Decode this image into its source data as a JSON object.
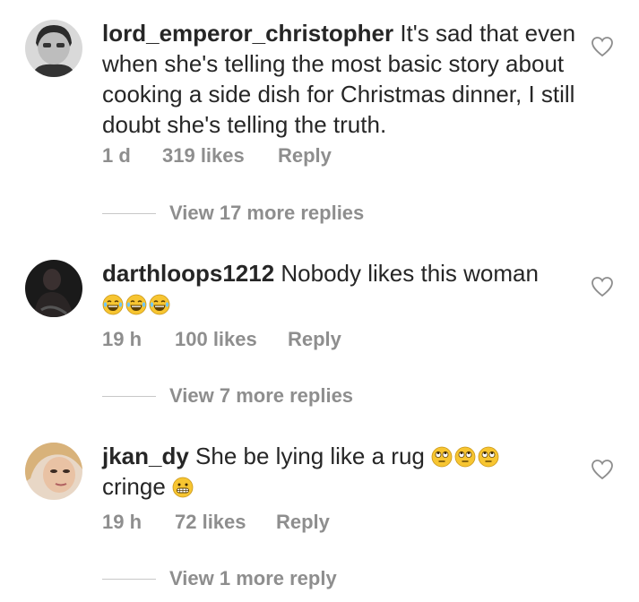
{
  "comments": [
    {
      "username": "lord_emperor_christopher",
      "text": " It's sad that even when she's telling the most basic story about cooking a side dish for Christmas dinner, I still doubt she's telling the truth.",
      "time": "1 d",
      "likes": "319 likes",
      "reply": "Reply",
      "view_replies": "View 17 more replies"
    },
    {
      "username": "darthloops1212",
      "text": " Nobody likes this woman",
      "emojis": [
        "laughing-tears-emoji",
        "laughing-tears-emoji",
        "laughing-tears-emoji"
      ],
      "time": "19 h",
      "likes": "100 likes",
      "reply": "Reply",
      "view_replies": "View 7 more replies"
    },
    {
      "username": "jkan_dy",
      "text": " She be lying like a rug ",
      "text2": "cringe ",
      "emojis": [
        "eye-roll-emoji",
        "eye-roll-emoji",
        "eye-roll-emoji"
      ],
      "emojis2": [
        "grimacing-emoji"
      ],
      "time": "19 h",
      "likes": "72 likes",
      "reply": "Reply",
      "view_replies": "View 1 more reply"
    }
  ],
  "colors": {
    "text": "#262626",
    "meta": "#8e8e8e",
    "emoji": "#f7c531"
  }
}
